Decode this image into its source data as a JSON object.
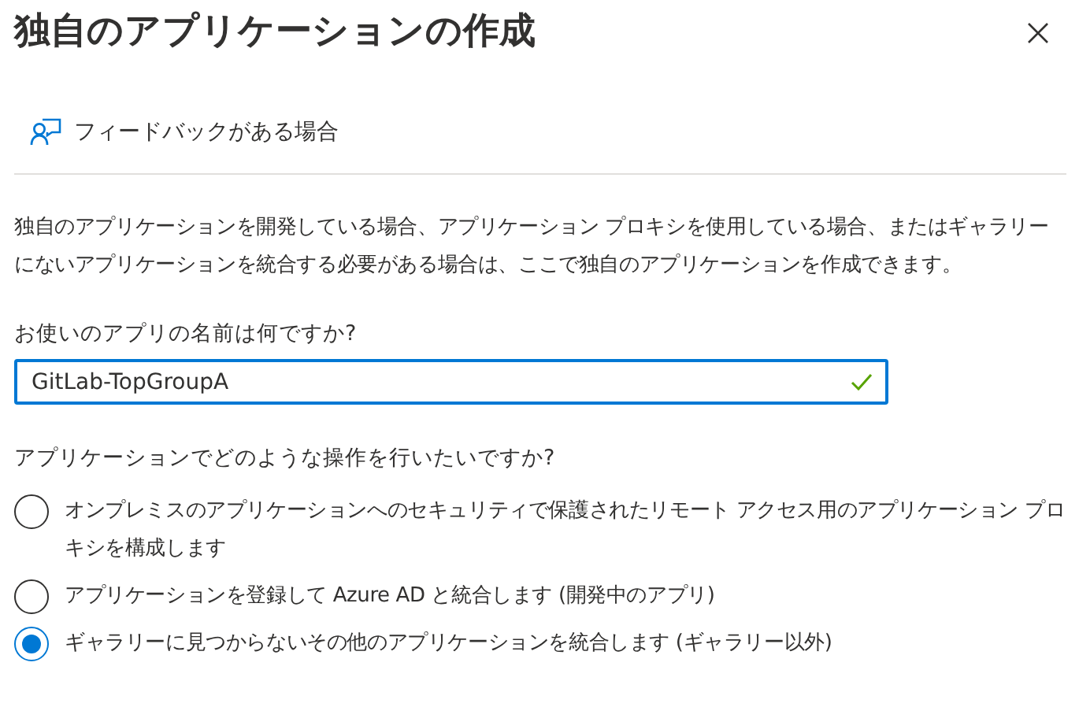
{
  "panel": {
    "title": "独自のアプリケーションの作成"
  },
  "feedback": {
    "label": "フィードバックがある場合"
  },
  "description": "独自のアプリケーションを開発している場合、アプリケーション プロキシを使用している場合、またはギャラリーにないアプリケーションを統合する必要がある場合は、ここで独自のアプリケーションを作成できます。",
  "name_field": {
    "label": "お使いのアプリの名前は何ですか?",
    "value": "GitLab-TopGroupA",
    "valid": true
  },
  "options_label": "アプリケーションでどのような操作を行いたいですか?",
  "options": [
    {
      "label": "オンプレミスのアプリケーションへのセキュリティで保護されたリモート アクセス用のアプリケーション プロキシを構成します",
      "selected": false
    },
    {
      "label": "アプリケーションを登録して Azure AD と統合します (開発中のアプリ)",
      "selected": false
    },
    {
      "label": "ギャラリーに見つからないその他のアプリケーションを統合します (ギャラリー以外)",
      "selected": true
    }
  ]
}
